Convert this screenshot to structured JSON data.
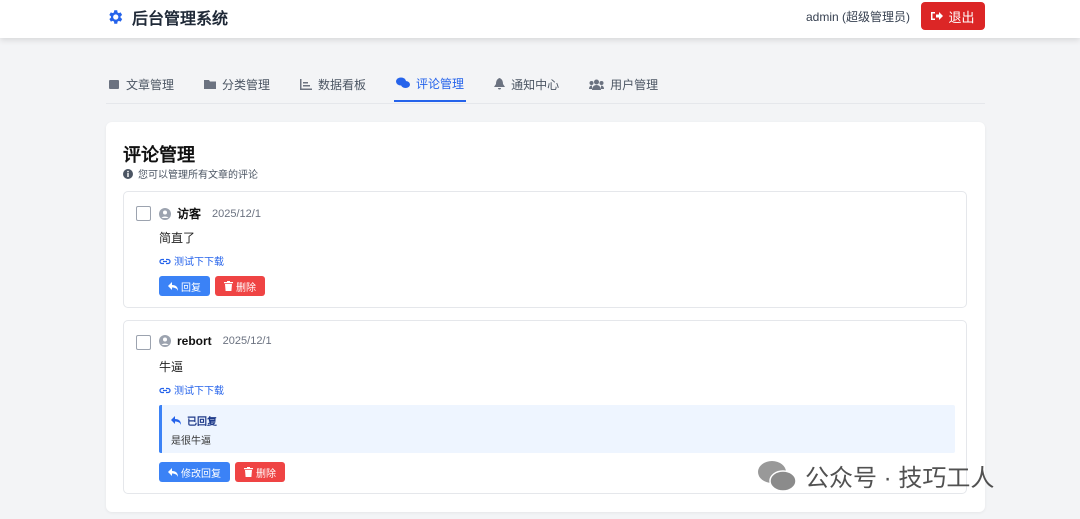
{
  "header": {
    "title": "后台管理系统",
    "user": "admin (超级管理员)",
    "logout": "退出"
  },
  "tabs": [
    {
      "label": "文章管理"
    },
    {
      "label": "分类管理"
    },
    {
      "label": "数据看板"
    },
    {
      "label": "评论管理",
      "active": true
    },
    {
      "label": "通知中心"
    },
    {
      "label": "用户管理"
    }
  ],
  "page": {
    "title": "评论管理",
    "subtitle": "您可以管理所有文章的评论"
  },
  "comments": [
    {
      "author": "访客",
      "date": "2025/12/1",
      "content": "简直了",
      "article": "测试下下载",
      "reply_btn": "回复",
      "delete_btn": "删除"
    },
    {
      "author": "rebort",
      "date": "2025/12/1",
      "content": "牛逼",
      "article": "测试下下载",
      "replied_label": "已回复",
      "reply_text": "是很牛逼",
      "reply_btn": "修改回复",
      "delete_btn": "删除"
    }
  ],
  "watermark": "公众号 · 技巧工人",
  "colors": {
    "accent": "#2563eb",
    "danger": "#ef4444",
    "logout": "#dc2626"
  }
}
